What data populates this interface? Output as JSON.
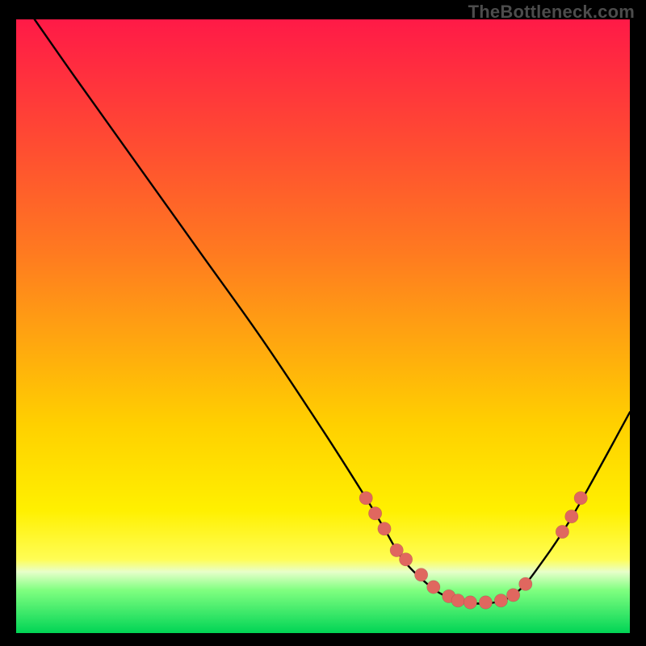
{
  "watermark": "TheBottleneck.com",
  "chart_data": {
    "type": "line",
    "title": "",
    "xlabel": "",
    "ylabel": "",
    "xlim": [
      0,
      100
    ],
    "ylim": [
      0,
      100
    ],
    "grid": false,
    "legend": false,
    "series": [
      {
        "name": "bottleneck-curve",
        "x": [
          3,
          10,
          20,
          30,
          40,
          50,
          57,
          60,
          63,
          67,
          70,
          73,
          78,
          82,
          86,
          90,
          94,
          100
        ],
        "y": [
          100,
          90,
          76,
          62,
          48,
          33,
          22,
          17,
          12,
          8,
          6,
          5,
          5,
          7,
          12,
          18,
          25,
          36
        ]
      }
    ],
    "highlighted_points": {
      "name": "markers",
      "x": [
        57,
        58.5,
        60,
        62,
        63.5,
        66,
        68,
        70.5,
        72,
        74,
        76.5,
        79,
        81,
        83,
        89,
        90.5,
        92
      ],
      "y": [
        22,
        19.5,
        17,
        13.5,
        12,
        9.5,
        7.5,
        6,
        5.3,
        5,
        5,
        5.3,
        6.2,
        8,
        16.5,
        19,
        22
      ]
    }
  }
}
